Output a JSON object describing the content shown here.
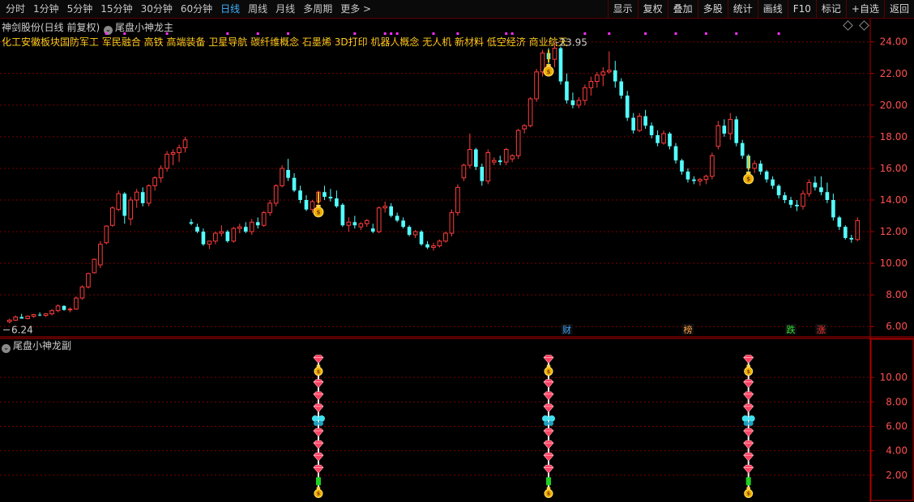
{
  "toolbar": {
    "periods": [
      "分时",
      "1分钟",
      "5分钟",
      "15分钟",
      "30分钟",
      "60分钟",
      "日线",
      "周线",
      "月线",
      "多周期",
      "更多 >"
    ],
    "active_period": "日线",
    "buttons": [
      "显示",
      "复权",
      "叠加",
      "多股",
      "统计",
      "画线",
      "F10",
      "标记",
      "+自选",
      "返回"
    ]
  },
  "main_panel": {
    "stock_title": "神剑股份(日线 前复权)",
    "indicator_name": "尾盘小神龙主",
    "concepts": "化工安徽板块国防军工 军民融合 高铁 高端装备 卫星导航 碳纤维概念 石墨烯 3D打印 机器人概念 无人机 新材料 低空经济 商业航天",
    "high_label": "23.95",
    "low_label": "6.24",
    "markers": [
      {
        "text": "财",
        "color": "#3aa0ff"
      },
      {
        "text": "榜",
        "color": "#ffa040"
      },
      {
        "text": "跌",
        "color": "#30e030"
      },
      {
        "text": "涨",
        "color": "#ff3030"
      }
    ]
  },
  "sub_panel": {
    "indicator_name": "尾盘小神龙副"
  },
  "colors": {
    "up": "#ff3c3c",
    "down": "#54ffff",
    "grid": "#7a0000",
    "axis_text": "#ff5050",
    "ma": "#ffffff"
  },
  "chart_data": {
    "type": "candlestick",
    "title": "神剑股份(日线 前复权)",
    "xlabel": "",
    "ylabel": "",
    "ylim": [
      5.5,
      24.6
    ],
    "yticks": [
      6,
      8,
      10,
      12,
      14,
      16,
      18,
      20,
      22,
      24
    ],
    "sub_ylim": [
      0,
      12
    ],
    "sub_yticks": [
      2,
      4,
      6,
      8,
      10
    ],
    "grid": true,
    "ohlc": [
      [
        6.3,
        6.5,
        6.2,
        6.4
      ],
      [
        6.4,
        6.7,
        6.35,
        6.6
      ],
      [
        6.6,
        6.8,
        6.5,
        6.5
      ],
      [
        6.5,
        6.7,
        6.45,
        6.65
      ],
      [
        6.65,
        6.8,
        6.55,
        6.75
      ],
      [
        6.75,
        6.9,
        6.65,
        6.7
      ],
      [
        6.7,
        6.85,
        6.6,
        6.8
      ],
      [
        6.8,
        7.1,
        6.7,
        7.0
      ],
      [
        7.0,
        7.4,
        6.9,
        7.3
      ],
      [
        7.3,
        7.35,
        7.0,
        7.05
      ],
      [
        7.05,
        7.2,
        6.9,
        7.1
      ],
      [
        7.1,
        7.9,
        7.05,
        7.8
      ],
      [
        7.8,
        8.6,
        7.7,
        8.5
      ],
      [
        8.5,
        9.4,
        8.4,
        9.35
      ],
      [
        9.4,
        10.3,
        9.35,
        10.25
      ],
      [
        9.9,
        11.4,
        9.7,
        11.2
      ],
      [
        11.3,
        12.4,
        11.2,
        12.35
      ],
      [
        12.4,
        13.6,
        12.3,
        13.5
      ],
      [
        13.4,
        14.6,
        13.3,
        14.4
      ],
      [
        14.4,
        14.5,
        12.5,
        13.0
      ],
      [
        12.8,
        14.2,
        12.4,
        14.0
      ],
      [
        14.0,
        14.7,
        13.5,
        14.5
      ],
      [
        14.5,
        14.8,
        13.6,
        13.8
      ],
      [
        13.8,
        15.0,
        13.6,
        14.9
      ],
      [
        14.9,
        15.5,
        14.6,
        15.4
      ],
      [
        15.4,
        16.2,
        15.1,
        16.0
      ],
      [
        16.0,
        17.1,
        15.8,
        16.9
      ],
      [
        16.9,
        17.2,
        16.2,
        17.0
      ],
      [
        17.0,
        17.5,
        16.4,
        17.3
      ],
      [
        17.3,
        18.0,
        17.0,
        17.8
      ],
      [
        12.6,
        12.8,
        12.4,
        12.5
      ],
      [
        12.3,
        12.5,
        11.9,
        12.0
      ],
      [
        12.0,
        12.2,
        11.1,
        11.2
      ],
      [
        11.2,
        11.4,
        10.9,
        11.4
      ],
      [
        11.4,
        12.0,
        11.2,
        11.9
      ],
      [
        11.9,
        12.4,
        11.7,
        12.0
      ],
      [
        12.0,
        12.1,
        11.3,
        11.4
      ],
      [
        11.4,
        12.3,
        11.3,
        12.2
      ],
      [
        12.2,
        12.5,
        11.9,
        12.3
      ],
      [
        12.3,
        12.6,
        11.9,
        12.0
      ],
      [
        12.0,
        12.8,
        11.8,
        12.6
      ],
      [
        12.6,
        12.9,
        12.2,
        12.4
      ],
      [
        12.4,
        13.3,
        12.3,
        13.2
      ],
      [
        13.2,
        14.0,
        13.0,
        13.8
      ],
      [
        13.8,
        15.0,
        13.6,
        14.9
      ],
      [
        14.9,
        16.2,
        14.8,
        16.0
      ],
      [
        15.9,
        16.6,
        15.2,
        15.4
      ],
      [
        15.4,
        15.7,
        14.5,
        14.6
      ],
      [
        14.6,
        14.9,
        13.8,
        14.0
      ],
      [
        14.0,
        14.3,
        13.3,
        13.4
      ],
      [
        13.4,
        14.0,
        13.2,
        13.9
      ],
      [
        13.9,
        14.6,
        13.7,
        14.5
      ],
      [
        14.5,
        14.9,
        14.0,
        14.2
      ],
      [
        14.2,
        14.7,
        13.9,
        14.1
      ],
      [
        14.1,
        14.6,
        13.5,
        13.6
      ],
      [
        13.7,
        13.8,
        12.3,
        12.4
      ],
      [
        12.4,
        12.9,
        12.0,
        12.6
      ],
      [
        12.6,
        13.0,
        12.2,
        12.4
      ],
      [
        12.3,
        12.6,
        12.1,
        12.5
      ],
      [
        12.5,
        12.8,
        12.3,
        12.7
      ],
      [
        12.2,
        12.5,
        11.9,
        12.0
      ],
      [
        12.0,
        13.6,
        11.9,
        13.5
      ],
      [
        13.5,
        13.9,
        13.2,
        13.6
      ],
      [
        13.6,
        13.8,
        12.9,
        13.0
      ],
      [
        13.0,
        13.2,
        12.6,
        12.7
      ],
      [
        12.7,
        12.9,
        12.2,
        12.3
      ],
      [
        12.3,
        12.4,
        11.7,
        11.8
      ],
      [
        11.8,
        12.1,
        11.6,
        12.0
      ],
      [
        12.0,
        12.1,
        11.1,
        11.2
      ],
      [
        11.2,
        11.4,
        10.9,
        11.0
      ],
      [
        11.0,
        11.3,
        10.8,
        11.1
      ],
      [
        11.1,
        11.5,
        11.0,
        11.4
      ],
      [
        11.4,
        12.0,
        11.3,
        11.9
      ],
      [
        11.9,
        13.4,
        11.7,
        13.2
      ],
      [
        13.2,
        15.0,
        13.0,
        14.8
      ],
      [
        15.4,
        16.3,
        15.2,
        16.2
      ],
      [
        16.2,
        18.2,
        16.0,
        17.2
      ],
      [
        17.2,
        17.3,
        15.9,
        16.1
      ],
      [
        16.1,
        16.3,
        14.9,
        15.2
      ],
      [
        15.2,
        17.2,
        15.0,
        17.0
      ],
      [
        16.4,
        16.7,
        16.2,
        16.5
      ],
      [
        16.5,
        16.8,
        16.2,
        16.4
      ],
      [
        16.4,
        17.3,
        16.2,
        17.2
      ],
      [
        16.6,
        16.9,
        16.4,
        16.8
      ],
      [
        16.8,
        18.5,
        16.6,
        18.4
      ],
      [
        18.5,
        18.8,
        18.2,
        18.7
      ],
      [
        18.7,
        20.5,
        18.6,
        20.4
      ],
      [
        20.4,
        22.3,
        20.2,
        22.1
      ],
      [
        22.1,
        23.5,
        21.8,
        23.3
      ],
      [
        23.3,
        23.6,
        22.6,
        22.9
      ],
      [
        22.9,
        23.95,
        22.4,
        23.6
      ],
      [
        23.6,
        23.7,
        21.3,
        21.5
      ],
      [
        21.5,
        22.0,
        20.1,
        20.3
      ],
      [
        20.3,
        20.8,
        19.8,
        20.0
      ],
      [
        20.0,
        20.5,
        19.8,
        20.3
      ],
      [
        20.3,
        21.3,
        20.0,
        21.1
      ],
      [
        21.1,
        21.8,
        20.6,
        21.5
      ],
      [
        21.5,
        22.1,
        21.1,
        21.9
      ],
      [
        21.9,
        22.4,
        21.2,
        22.1
      ],
      [
        22.1,
        23.4,
        22.0,
        22.2
      ],
      [
        22.2,
        22.8,
        21.1,
        21.5
      ],
      [
        21.5,
        21.7,
        20.4,
        20.6
      ],
      [
        20.6,
        20.9,
        19.0,
        19.2
      ],
      [
        19.2,
        19.5,
        18.2,
        18.4
      ],
      [
        18.4,
        19.5,
        18.3,
        19.3
      ],
      [
        19.3,
        19.7,
        18.5,
        18.7
      ],
      [
        18.7,
        18.9,
        17.9,
        18.1
      ],
      [
        18.1,
        18.4,
        17.4,
        17.6
      ],
      [
        17.6,
        18.4,
        17.5,
        18.2
      ],
      [
        18.2,
        18.3,
        17.2,
        17.4
      ],
      [
        17.4,
        17.6,
        16.3,
        16.5
      ],
      [
        16.5,
        16.6,
        15.6,
        15.8
      ],
      [
        15.8,
        16.0,
        15.1,
        15.3
      ],
      [
        15.3,
        15.5,
        15.0,
        15.2
      ],
      [
        15.2,
        15.4,
        14.9,
        15.3
      ],
      [
        15.3,
        15.6,
        15.0,
        15.5
      ],
      [
        15.5,
        17.0,
        15.3,
        16.8
      ],
      [
        17.4,
        19.0,
        17.2,
        18.7
      ],
      [
        18.7,
        19.1,
        18.0,
        18.2
      ],
      [
        18.2,
        19.5,
        17.8,
        19.1
      ],
      [
        19.1,
        19.3,
        17.4,
        17.6
      ],
      [
        17.6,
        17.8,
        16.6,
        16.8
      ],
      [
        16.8,
        16.9,
        15.8,
        16.0
      ],
      [
        16.0,
        16.5,
        15.7,
        16.3
      ],
      [
        16.3,
        16.5,
        15.6,
        15.8
      ],
      [
        15.8,
        15.9,
        15.1,
        15.3
      ],
      [
        15.3,
        15.5,
        14.7,
        14.9
      ],
      [
        14.9,
        15.0,
        14.1,
        14.3
      ],
      [
        14.3,
        14.5,
        13.8,
        14.0
      ],
      [
        14.0,
        14.2,
        13.5,
        13.7
      ],
      [
        13.7,
        14.0,
        13.3,
        13.6
      ],
      [
        13.6,
        14.6,
        13.4,
        14.4
      ],
      [
        14.4,
        15.3,
        14.2,
        15.1
      ],
      [
        15.1,
        15.5,
        14.6,
        14.8
      ],
      [
        14.8,
        15.5,
        14.3,
        14.5
      ],
      [
        14.5,
        15.1,
        13.8,
        14.0
      ],
      [
        14.0,
        14.4,
        12.7,
        12.9
      ],
      [
        12.9,
        13.0,
        12.1,
        12.3
      ],
      [
        12.3,
        12.4,
        11.5,
        11.6
      ],
      [
        11.6,
        11.8,
        11.3,
        11.5
      ],
      [
        11.5,
        12.9,
        11.4,
        12.7
      ]
    ],
    "signal_days": [
      51,
      89,
      122
    ],
    "main_signal_days": [
      51,
      89,
      122
    ],
    "top_dots_days": [
      16,
      19,
      26,
      36,
      41,
      46,
      57,
      62,
      63,
      64,
      70,
      74,
      82,
      83,
      95,
      99,
      105,
      110,
      115,
      120,
      127
    ]
  }
}
